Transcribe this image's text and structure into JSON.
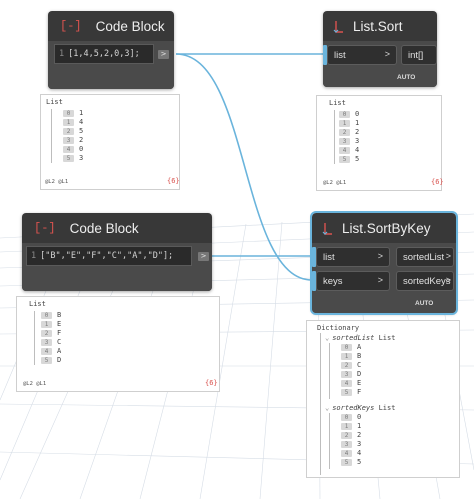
{
  "colors": {
    "wire": "#6ab4dc",
    "node_header": "#383838",
    "node_body": "#4a4a4a",
    "selected_outline": "#6ab4dc",
    "grid_line": "#d6dde6",
    "count_badge": "#d9534f"
  },
  "nodes": {
    "code_block_1": {
      "icon": "code-block-icon",
      "icon_glyph": "[-]",
      "title": "Code Block",
      "line_no": "1",
      "code": "[1,4,5,2,0,3];",
      "out_port": ">"
    },
    "code_block_2": {
      "icon": "code-block-icon",
      "icon_glyph": "[-]",
      "title": "Code Block",
      "line_no": "1",
      "code": "[\"B\",\"E\",\"F\",\"C\",\"A\",\"D\"];",
      "out_port": ">"
    },
    "list_sort": {
      "icon": "function-icon",
      "title": "List.Sort",
      "inputs": [
        {
          "label": "list",
          "chevron": ">"
        }
      ],
      "outputs": [
        {
          "label": "int[]"
        }
      ],
      "lacing": "AUTO"
    },
    "list_sort_by_key": {
      "icon": "function-icon",
      "title": "List.SortByKey",
      "inputs": [
        {
          "label": "list",
          "chevron": ">"
        },
        {
          "label": "keys",
          "chevron": ">"
        }
      ],
      "outputs": [
        {
          "label": "sortedList",
          "chevron": ">"
        },
        {
          "label": "sortedKeys",
          "chevron": ">"
        }
      ],
      "lacing": "AUTO"
    }
  },
  "previews": {
    "code_block_1": {
      "title": "List",
      "items": [
        {
          "i": "0",
          "v": "1"
        },
        {
          "i": "1",
          "v": "4"
        },
        {
          "i": "2",
          "v": "5"
        },
        {
          "i": "3",
          "v": "2"
        },
        {
          "i": "4",
          "v": "0"
        },
        {
          "i": "5",
          "v": "3"
        }
      ],
      "levels": "@L2 @L1",
      "count": "{6}"
    },
    "code_block_2": {
      "title": "List",
      "items": [
        {
          "i": "0",
          "v": "B"
        },
        {
          "i": "1",
          "v": "E"
        },
        {
          "i": "2",
          "v": "F"
        },
        {
          "i": "3",
          "v": "C"
        },
        {
          "i": "4",
          "v": "A"
        },
        {
          "i": "5",
          "v": "D"
        }
      ],
      "levels": "@L2 @L1",
      "count": "{6}"
    },
    "list_sort": {
      "title": "List",
      "items": [
        {
          "i": "0",
          "v": "0"
        },
        {
          "i": "1",
          "v": "1"
        },
        {
          "i": "2",
          "v": "2"
        },
        {
          "i": "3",
          "v": "3"
        },
        {
          "i": "4",
          "v": "4"
        },
        {
          "i": "5",
          "v": "5"
        }
      ],
      "levels": "@L2 @L1",
      "count": "{6}"
    },
    "list_sort_by_key": {
      "title": "Dictionary",
      "sorted_list_key": "sortedList",
      "sorted_list_type": "List",
      "sorted_list": [
        {
          "i": "0",
          "v": "A"
        },
        {
          "i": "1",
          "v": "B"
        },
        {
          "i": "2",
          "v": "C"
        },
        {
          "i": "3",
          "v": "D"
        },
        {
          "i": "4",
          "v": "E"
        },
        {
          "i": "5",
          "v": "F"
        }
      ],
      "sorted_keys_key": "sortedKeys",
      "sorted_keys_type": "List",
      "sorted_keys": [
        {
          "i": "0",
          "v": "0"
        },
        {
          "i": "1",
          "v": "1"
        },
        {
          "i": "2",
          "v": "2"
        },
        {
          "i": "3",
          "v": "3"
        },
        {
          "i": "4",
          "v": "4"
        },
        {
          "i": "5",
          "v": "5"
        }
      ]
    }
  }
}
